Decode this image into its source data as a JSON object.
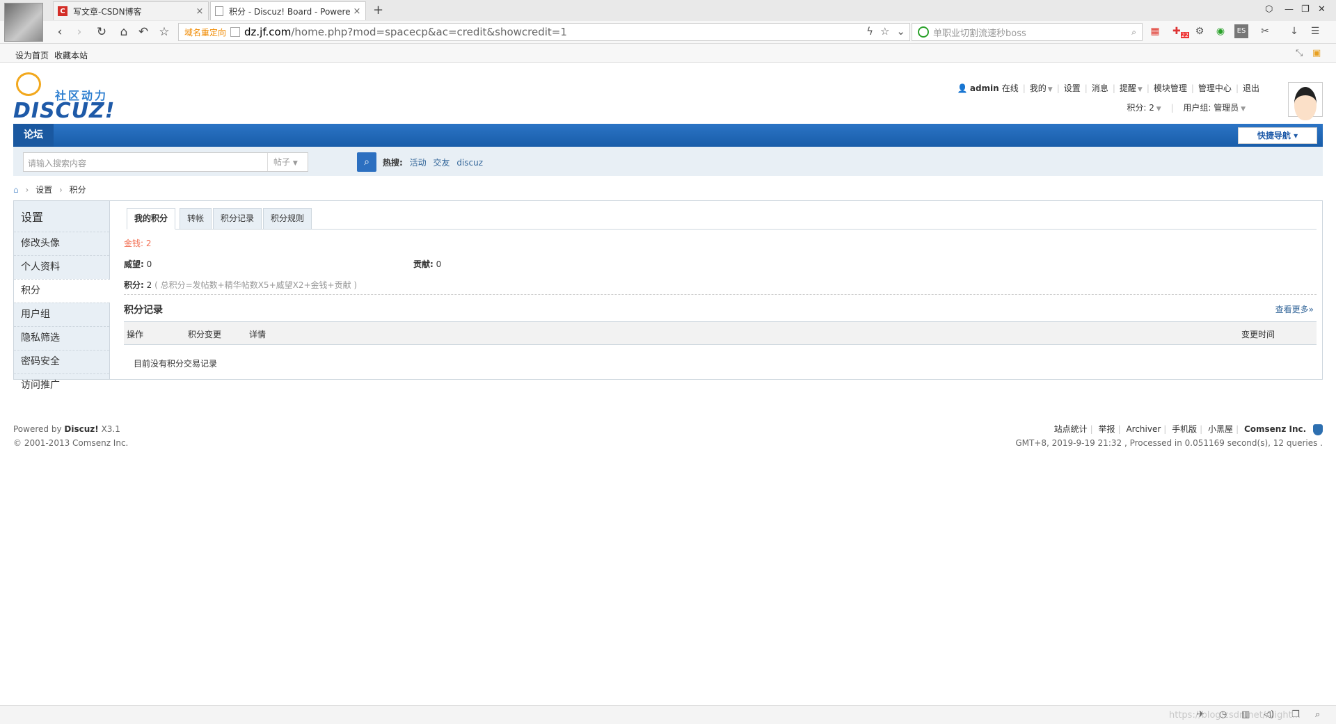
{
  "browser": {
    "tabs": [
      {
        "title": "写文章-CSDN博客",
        "favicon": "C"
      },
      {
        "title": "积分 - Discuz! Board - Powere"
      }
    ],
    "url": {
      "redirect_label": "域名重定向",
      "domain": "dz.jf.com",
      "path": "/home.php?mod=spacecp&ac=credit&showcredit=1"
    },
    "search_placeholder": "单职业切割流速秒boss",
    "extension_badge": "22",
    "bookmarks": [
      "设为首页",
      "收藏本站"
    ]
  },
  "site": {
    "logo_sub": "社区动力",
    "logo_main": "DISCUZ!",
    "user": {
      "name": "admin",
      "status": "在线",
      "links": [
        "我的",
        "设置",
        "消息",
        "提醒",
        "模块管理",
        "管理中心",
        "退出"
      ],
      "credit_label": "积分: 2",
      "group_label": "用户组: 管理员"
    },
    "nav_home": "论坛",
    "quick_nav": "快捷导航",
    "search": {
      "placeholder": "请输入搜索内容",
      "category": "帖子",
      "hot_label": "热搜:",
      "hot_words": [
        "活动",
        "交友",
        "discuz"
      ]
    },
    "breadcrumb": [
      "设置",
      "积分"
    ]
  },
  "sidebar": {
    "title": "设置",
    "items": [
      "修改头像",
      "个人资料",
      "积分",
      "用户组",
      "隐私筛选",
      "密码安全",
      "访问推广"
    ],
    "active": "积分"
  },
  "credit": {
    "tabs": [
      "我的积分",
      "转帐",
      "积分记录",
      "积分规则"
    ],
    "money_label": "金钱:",
    "money_value": "2",
    "prestige_label": "威望:",
    "prestige_value": "0",
    "contribution_label": "贡献:",
    "contribution_value": "0",
    "total_label": "积分:",
    "total_value": "2",
    "total_formula": "( 总积分=发帖数+精华帖数X5+威望X2+金钱+贡献 )",
    "log_title": "积分记录",
    "view_more": "查看更多»",
    "columns": [
      "操作",
      "积分变更",
      "详情",
      "变更时间"
    ],
    "empty_text": "目前没有积分交易记录"
  },
  "footer": {
    "powered_prefix": "Powered by",
    "powered_name": "Discuz!",
    "version": "X3.1",
    "copyright": "© 2001-2013 Comsenz Inc.",
    "links": [
      "站点统计",
      "举报",
      "Archiver",
      "手机版",
      "小黑屋"
    ],
    "company": "Comsenz Inc.",
    "stats": "GMT+8, 2019-9-19 21:32 , Processed in 0.051169 second(s), 12 queries ."
  },
  "statusbar": {
    "watermark": "https://blog.csdn.net/Alight..."
  },
  "colors": {
    "nav_blue": "#195da9",
    "accent_red": "#f26c4f",
    "link_blue": "#336699",
    "redirect_orange": "#f08a00"
  }
}
